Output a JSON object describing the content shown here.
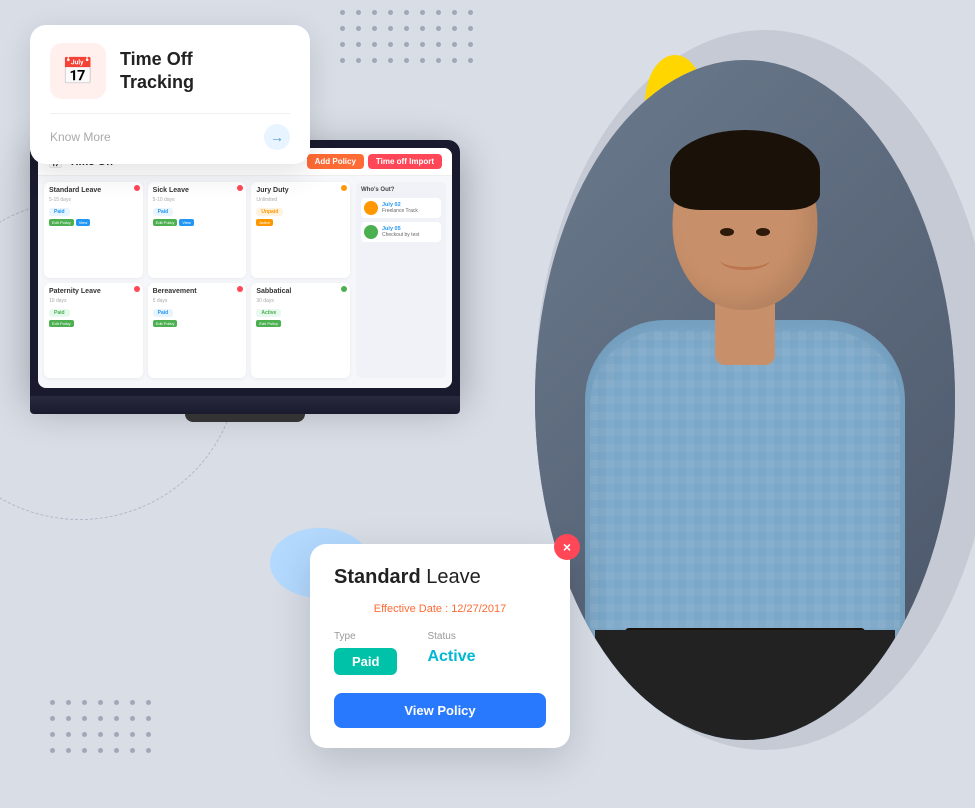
{
  "scene": {
    "bg_color": "#d0d5de"
  },
  "tracking_card": {
    "title": "Time Off\nTracking",
    "know_more": "Know More",
    "icon": "📅"
  },
  "laptop_screen": {
    "title": "Time Off",
    "btn_add_policy": "Add Policy",
    "btn_time_off_import": "Time off Import",
    "cards": [
      {
        "title": "Standard Leave",
        "badge": "Paid",
        "badge_type": "blue"
      },
      {
        "title": "Sick Leave",
        "badge": "Paid",
        "badge_type": "blue"
      },
      {
        "title": "Jury Duty",
        "badge": "Unpaid",
        "badge_type": "orange"
      },
      {
        "title": "Paternity Leave",
        "badge": "Paid",
        "badge_type": "green"
      },
      {
        "title": "Bereavement",
        "badge": "Paid",
        "badge_type": "blue"
      },
      {
        "title": "Sabbatical",
        "badge": "Active",
        "badge_type": "green"
      }
    ],
    "events": [
      {
        "date": "July 02",
        "text": "Freelance Track"
      },
      {
        "date": "July 05",
        "text": "Checkout by test"
      }
    ]
  },
  "leave_card": {
    "title_normal": "Standard",
    "title_bold": "Leave",
    "effective_label": "Effective Date :",
    "effective_date": "12/27/2017",
    "type_label": "Type",
    "type_value": "Paid",
    "status_label": "Status",
    "status_value": "Active",
    "button_label": "View Policy",
    "close_icon": "×"
  },
  "decorative": {
    "yellow_blob_color": "#ffd600",
    "blue_blob_color": "#b3d9ff"
  }
}
